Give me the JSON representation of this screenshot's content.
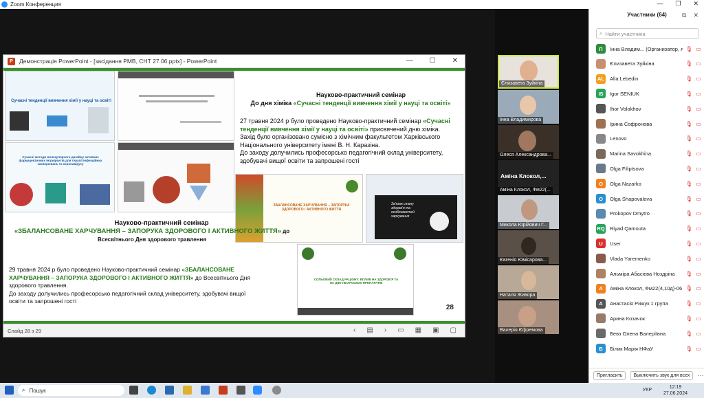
{
  "zoom": {
    "title": "Zoom Конференция"
  },
  "ppt": {
    "title": "Демонстрація PowerPoint - [засідання РМВ, СНТ 27.06.pptx] - PowerPoint",
    "status": "Слайд 28 з 29"
  },
  "slide": {
    "seminar1_heading": "Науково-практичний семінар",
    "seminar1_sub_prefix": "До дня хіміка ",
    "seminar1_sub_green": "«Сучасні тенденції вивчення хімії у науці та освіті»",
    "seminar1_p1": "27 травня 2024 р було проведено Науково-практичний семінар ",
    "seminar1_p1_green": "«Сучасні тенденції вивчення хімії у науці та освіті»",
    "seminar1_p1_end": " присвячений дню хіміка.",
    "seminar1_p2": "Захід було організовано сумісно з хімічним факультетом Харківського Національного університету імені В. Н. Каразіна.",
    "seminar1_p3": "До заходу долучились професорсько педагогічний склад університету, здобувачі вищої освіти та запрошені гості",
    "seminar2_heading": "Науково-практичний семінар",
    "seminar2_green": "«ЗБАЛАНСОВАНЕ ХАРЧУВАННЯ – ЗАПОРУКА ЗДОРОВОГО І АКТИВНОГО ЖИТТЯ»",
    "seminar2_suffix": " до Всесвітнього Дня здорового травлення",
    "seminar2_p1": "29 травня 2024 р було проведено Науково-практичний семінар ",
    "seminar2_p1_green": "«ЗБАЛАНСОВАНЕ ХАРЧУВАННЯ – ЗАПОРУКА ЗДОРОВОГО І АКТИВНОГО ЖИТТЯ»",
    "seminar2_p1_end": " до Всесвітнього Дня здорового травлення.",
    "seminar2_p2": "До заходу долучились професорсько педагогічний склад університету, здобувачі вищої освіти та запрошені гості",
    "thumb1_title": "Сучасні тенденції вивчення хімії у науці та освіті",
    "thumb_chem": "Сучасні методи молекулярного дизайну активних фармацевтичних інгредієнтів для терапії інфекційних захворювань та коронавірусу",
    "thumb_food_title": "ЗБАЛАНСОВАНЕ ХАРЧУВАННЯ – ЗАПОРУКА ЗДОРОВОГО І АКТИВНОГО ЖИТТЯ",
    "thumb_salt": "СОЛЬОВИЙ СКЛАД РАЦІОНУ: ВПЛИВ НА ЗДОРОВ'Я ТА НА ДІЮ ЛІКАРСЬКИХ ПРЕПАРАТІВ",
    "thumb_laptop": "Зв'язок стану здоров'я та особливостей харчування",
    "slide_number": "28"
  },
  "videos": [
    {
      "name": "Єлизавета Зуйкіна"
    },
    {
      "name": "Інна Владимирова"
    },
    {
      "name": "Олеся Александрова..."
    },
    {
      "name": "Аміна Клокол, Фм22(...",
      "label": "Аміна Клокол,..."
    },
    {
      "name": "Микола Юрійович Г..."
    },
    {
      "name": "Євгенія Юмісарова..."
    },
    {
      "name": "Наталя Живора"
    },
    {
      "name": "Валерія Єфремова"
    }
  ],
  "panel": {
    "title": "Участники (64)",
    "search_placeholder": "Найти участника",
    "invite": "Пригласить",
    "mute_all": "Выключить звук для всех",
    "participants": [
      {
        "initial": "П",
        "color": "#2e8b3d",
        "name": "Інна Владим...  (Организатор, я)"
      },
      {
        "initial": "",
        "color": "#c89070",
        "name": "Єлизавета Зуйкіна"
      },
      {
        "initial": "AL",
        "color": "#f0a020",
        "name": "Alla Lebedin"
      },
      {
        "initial": "IS",
        "color": "#27a35a",
        "name": "Igor SENIUK"
      },
      {
        "initial": "",
        "color": "#555555",
        "name": "Ihor Volokhov"
      },
      {
        "initial": "",
        "color": "#a07050",
        "name": "Ірина Софронова"
      },
      {
        "initial": "",
        "color": "#888888",
        "name": "Lenovo"
      },
      {
        "initial": "",
        "color": "#7a6a5a",
        "name": "Marina Savokhina"
      },
      {
        "initial": "",
        "color": "#6a7a8a",
        "name": "Olga Filiptsova"
      },
      {
        "initial": "O",
        "color": "#f08020",
        "name": "Olga Nazarko"
      },
      {
        "initial": "O",
        "color": "#2a8fd0",
        "name": "Olga Shapovalova"
      },
      {
        "initial": "",
        "color": "#5a8ab0",
        "name": "Prokopov Dmytro"
      },
      {
        "initial": "RQ",
        "color": "#27a35a",
        "name": "Riyad Qamouta"
      },
      {
        "initial": "U",
        "color": "#d9302c",
        "name": "User"
      },
      {
        "initial": "",
        "color": "#8a5a4a",
        "name": "Vlada Yaremenko"
      },
      {
        "initial": "",
        "color": "#b08060",
        "name": "Альміра Абасієва Ноздріна"
      },
      {
        "initial": "А",
        "color": "#f08020",
        "name": "Аміна Клокол, Фм22(4,10д)-06"
      },
      {
        "initial": "А",
        "color": "#555555",
        "name": "Анастасія Рижук 1 група"
      },
      {
        "initial": "",
        "color": "#9a7a6a",
        "name": "Арина Козачок"
      },
      {
        "initial": "",
        "color": "#6a6a6a",
        "name": "Бевз Олена Валеріївна"
      },
      {
        "initial": "Б",
        "color": "#2a8fd0",
        "name": "Білик Марія НФаУ"
      }
    ]
  },
  "taskbar": {
    "search": "Пошук",
    "lang": "УКР",
    "time": "12:19",
    "date": "27.06.2024"
  }
}
